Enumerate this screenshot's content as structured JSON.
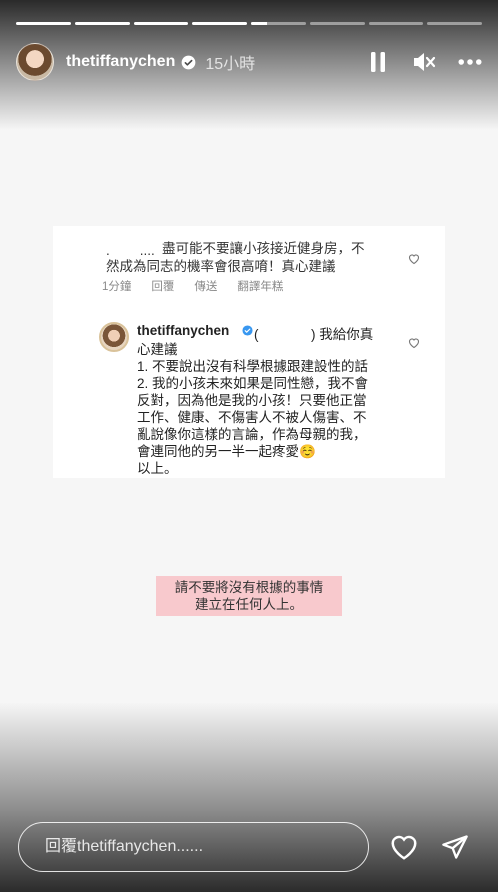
{
  "progress": {
    "segments": [
      1,
      1,
      1,
      1,
      0.3,
      0,
      0,
      0
    ]
  },
  "header": {
    "username": "thetiffanychen",
    "time": "15小時"
  },
  "post": {
    "comment_line1": "盡可能不要讓小孩接近健身房，不",
    "comment_line2": "然成為同志的機率會很高唷！真心建議",
    "comment_meta": [
      "1分鐘",
      "回覆",
      "傳送",
      "翻譯年糕"
    ],
    "reply_user": "thetiffanychen",
    "reply_mention": "我給你真",
    "reply_lines": [
      "心建議",
      "1. 不要說出沒有科學根據跟建設性的話",
      "2. 我的小孩未來如果是同性戀，我不會",
      "反對，因為他是我的小孩！只要他正當",
      "工作、健康、不傷害人不被人傷害、不",
      "亂說像你這樣的言論，作為母親的我，",
      "會連同他的另一半一起疼愛☺️",
      "以上。"
    ]
  },
  "caption": {
    "line1": "請不要將沒有根據的事情",
    "line2": "建立在任何人上。"
  },
  "footer": {
    "reply_placeholder": "回覆thetiffanychen......"
  },
  "colors": {
    "caption_bg": "#f8c9cd",
    "verified": "#3897f0"
  }
}
